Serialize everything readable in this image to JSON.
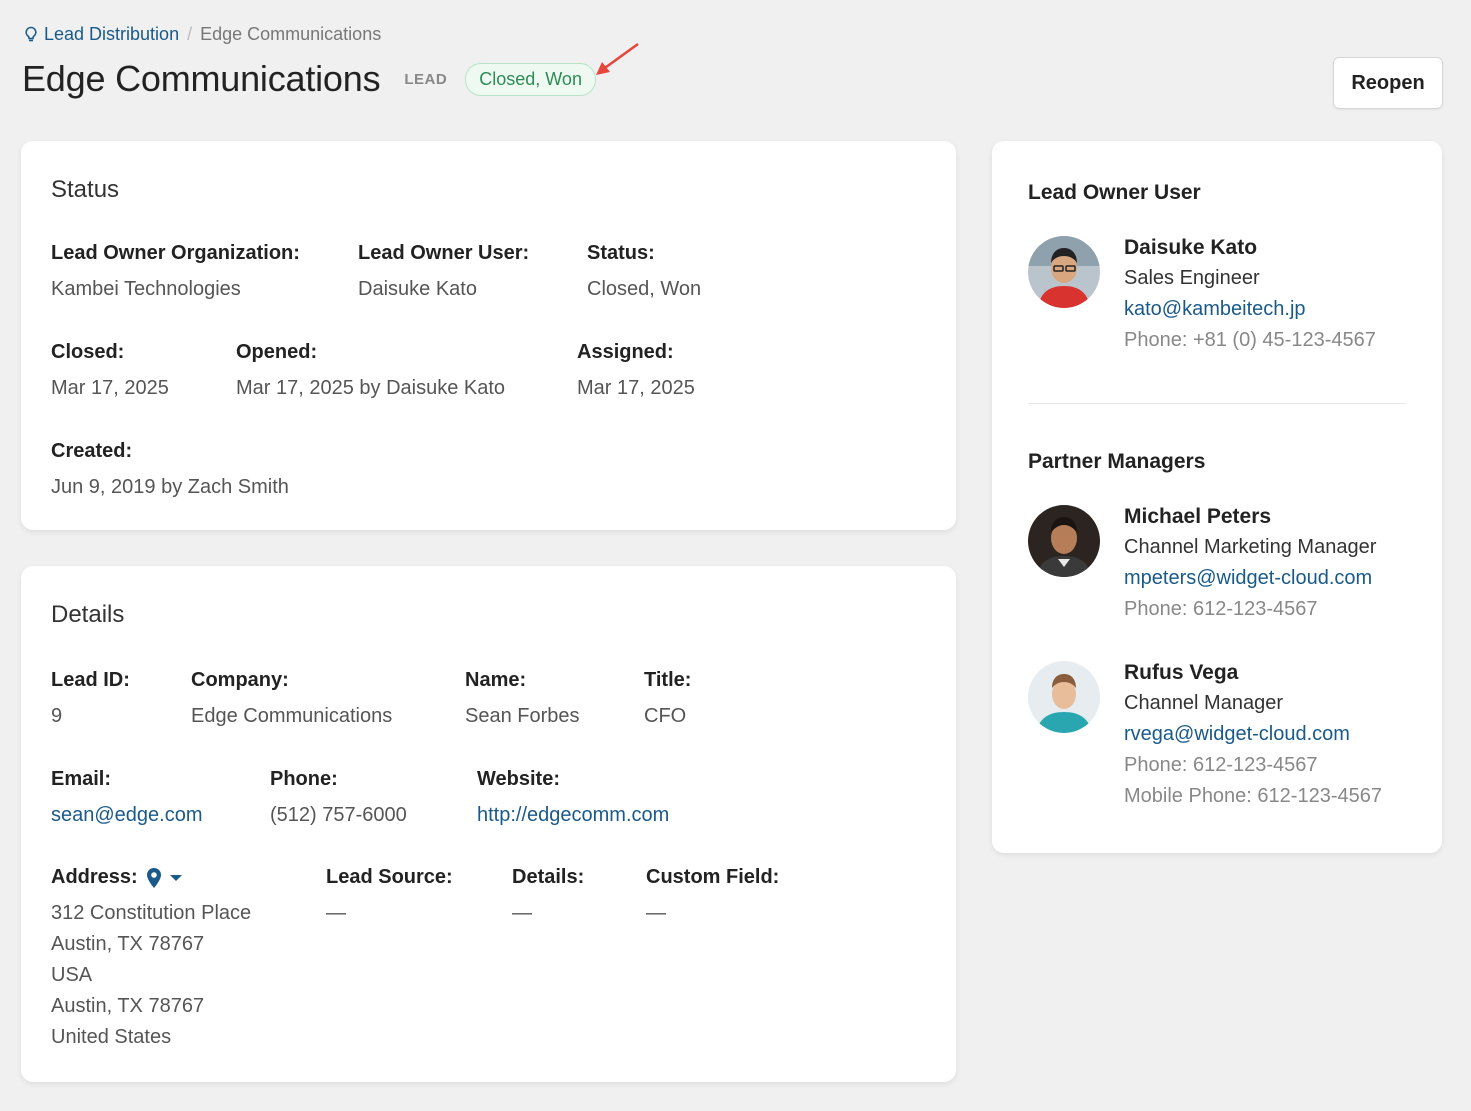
{
  "breadcrumb": {
    "icon": "lightbulb-icon",
    "parent": "Lead Distribution",
    "separator": "/",
    "current": "Edge Communications"
  },
  "header": {
    "title": "Edge Communications",
    "type_tag": "LEAD",
    "status_badge": "Closed, Won",
    "reopen_label": "Reopen"
  },
  "colors": {
    "link": "#1a5a8a",
    "badge_text": "#2e8b57",
    "badge_bg": "#eef9f1",
    "annotation_arrow": "#e8453c"
  },
  "status_card": {
    "title": "Status",
    "lead_owner_org_label": "Lead Owner Organization:",
    "lead_owner_org_value": "Kambei Technologies",
    "lead_owner_user_label": "Lead Owner User:",
    "lead_owner_user_value": "Daisuke Kato",
    "status_label": "Status:",
    "status_value": "Closed, Won",
    "closed_label": "Closed:",
    "closed_value": "Mar 17, 2025",
    "opened_label": "Opened:",
    "opened_value": "Mar 17, 2025 by Daisuke Kato",
    "assigned_label": "Assigned:",
    "assigned_value": "Mar 17, 2025",
    "created_label": "Created:",
    "created_value": "Jun 9, 2019 by Zach Smith"
  },
  "details_card": {
    "title": "Details",
    "lead_id_label": "Lead ID:",
    "lead_id_value": "9",
    "company_label": "Company:",
    "company_value": "Edge Communications",
    "name_label": "Name:",
    "name_value": "Sean Forbes",
    "title_label": "Title:",
    "title_value": "CFO",
    "email_label": "Email:",
    "email_value": "sean@edge.com",
    "phone_label": "Phone:",
    "phone_value": "(512) 757-6000",
    "website_label": "Website:",
    "website_value": "http://edgecomm.com",
    "address_label": "Address:",
    "address_lines": [
      "312 Constitution Place",
      "Austin, TX 78767",
      "USA",
      "Austin, TX 78767",
      "United States"
    ],
    "lead_source_label": "Lead Source:",
    "lead_source_value": "—",
    "details_label": "Details:",
    "details_value": "—",
    "custom_field_label": "Custom Field:",
    "custom_field_value": "—"
  },
  "sidebar": {
    "lead_owner_title": "Lead Owner User",
    "lead_owner": {
      "name": "Daisuke Kato",
      "role": "Sales Engineer",
      "email": "kato@kambeitech.jp",
      "phone": "Phone: +81 (0) 45-123-4567"
    },
    "partner_managers_title": "Partner Managers",
    "partner_managers": [
      {
        "name": "Michael Peters",
        "role": "Channel Marketing Manager",
        "email": "mpeters@widget-cloud.com",
        "phone": "Phone: 612-123-4567"
      },
      {
        "name": "Rufus Vega",
        "role": "Channel Manager",
        "email": "rvega@widget-cloud.com",
        "phone": "Phone: 612-123-4567",
        "mobile": "Mobile Phone: 612-123-4567"
      }
    ]
  }
}
